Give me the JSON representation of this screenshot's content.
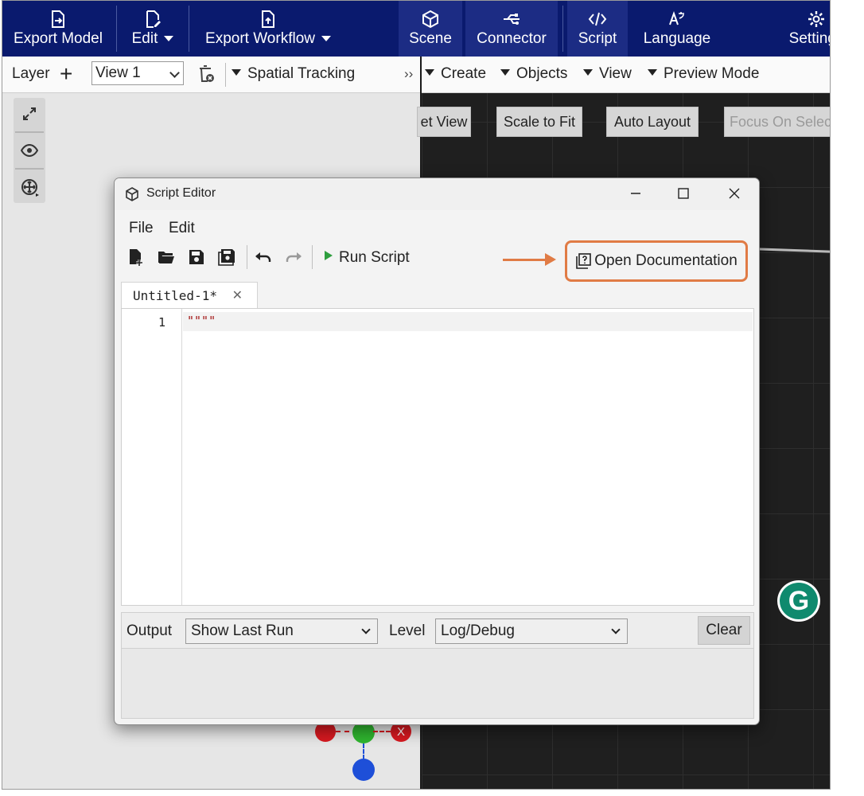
{
  "toolbar": {
    "export_model": "Export Model",
    "edit": "Edit",
    "export_workflow": "Export Workflow",
    "scene": "Scene",
    "connector": "Connector",
    "script": "Script",
    "language": "Language",
    "settings": "Settings"
  },
  "layer_bar": {
    "layer_label": "Layer",
    "view_select": "View 1",
    "spatial_tracking": "Spatial Tracking"
  },
  "right_menu": {
    "create": "Create",
    "objects": "Objects",
    "view": "View",
    "preview_mode": "Preview Mode"
  },
  "view_buttons": {
    "reset_view": "et View",
    "scale_to_fit": "Scale to Fit",
    "auto_layout": "Auto Layout",
    "focus_on_selection": "Focus On Selec"
  },
  "script_editor": {
    "title": "Script Editor",
    "menu_file": "File",
    "menu_edit": "Edit",
    "run_script": "Run Script",
    "open_documentation": "Open Documentation",
    "tab_name": "Untitled-1*",
    "line_number": "1",
    "code_line": "\"\"\"\"",
    "output_label": "Output",
    "output_select": "Show Last Run",
    "level_label": "Level",
    "level_select": "Log/Debug",
    "clear": "Clear"
  },
  "gizmo": {
    "x_axis_label": "X"
  },
  "badge": {
    "letter": "G"
  },
  "colors": {
    "toolbar_bg": "#0a1a6e",
    "highlight_orange": "#e07b45",
    "run_green": "#2e9e3e",
    "badge_green": "#0f8a6e"
  }
}
